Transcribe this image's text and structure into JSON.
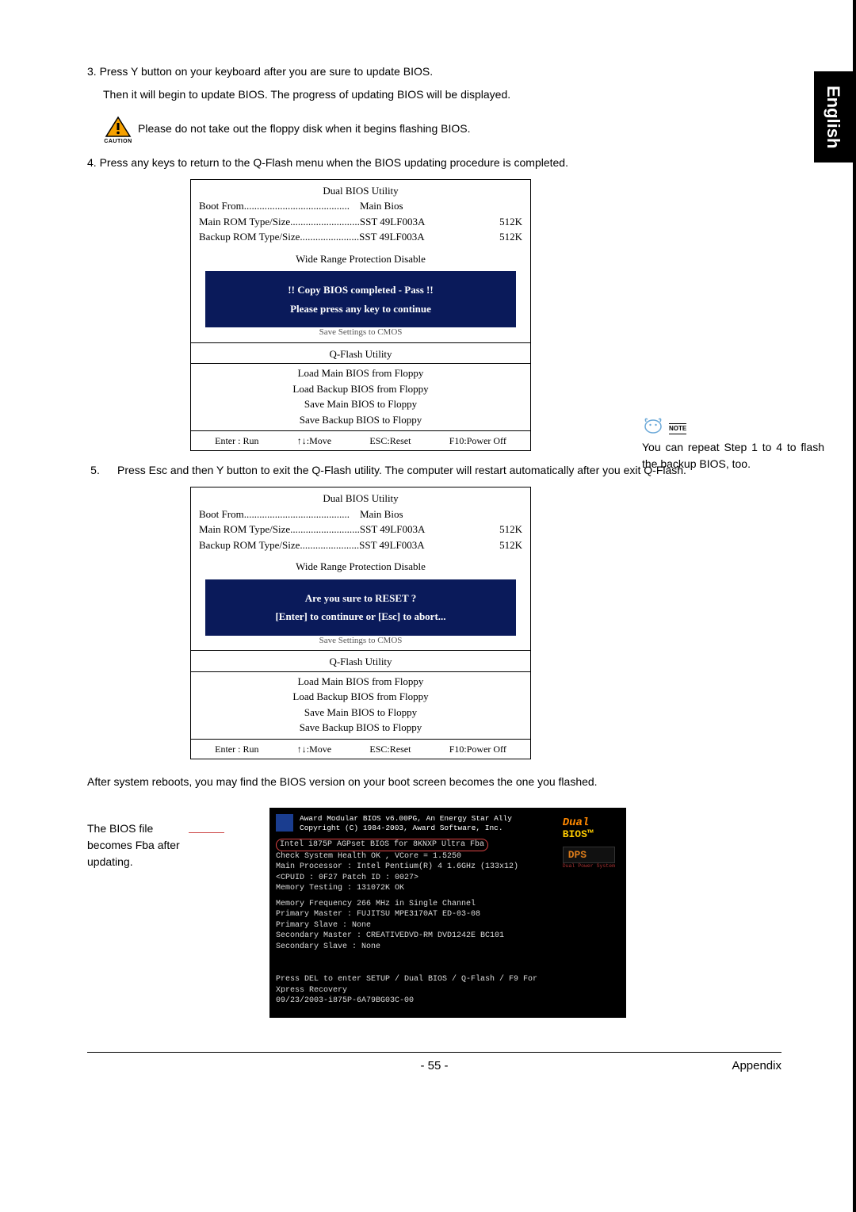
{
  "tab": "English",
  "step3": {
    "text": "3. Press Y button on your keyboard after you are sure to update BIOS.",
    "sub": "Then it will begin to update BIOS. The progress of updating BIOS will be displayed."
  },
  "caution": {
    "label": "CAUTION",
    "text": "Please do not take out the floppy disk when it begins flashing BIOS."
  },
  "step4": "4. Press any keys to return to the Q-Flash menu when the BIOS updating procedure is completed.",
  "bios1": {
    "title": "Dual BIOS Utility",
    "boot_from_lbl": "Boot From.........................................",
    "boot_from_val": "Main Bios",
    "main_rom_lbl": "Main ROM Type/Size...........................SST 49LF003A",
    "main_rom_val": "512K",
    "backup_rom_lbl": "Backup ROM Type/Size.......................SST 49LF003A",
    "backup_rom_val": "512K",
    "wrp": "Wide Range Protection     Disable",
    "banner1": "!! Copy BIOS completed - Pass !!",
    "banner2": "Please press any key to continue",
    "under": "Save Settings to CMOS",
    "qflash": "Q-Flash Utility",
    "m1": "Load Main BIOS from Floppy",
    "m2": "Load Backup BIOS from Floppy",
    "m3": "Save Main BIOS to Floppy",
    "m4": "Save Backup BIOS to Floppy",
    "f1": "Enter : Run",
    "f2": "↑↓:Move",
    "f3": "ESC:Reset",
    "f4": "F10:Power Off"
  },
  "note": {
    "label": "NOTE",
    "text": "You can repeat Step 1 to 4 to flash the backup BIOS, too."
  },
  "step5": {
    "num": "5.",
    "text": "Press Esc and then Y button to exit the Q-Flash utility. The computer will restart automatically after you exit Q-Flash."
  },
  "bios2": {
    "title": "Dual BIOS Utility",
    "boot_from_lbl": "Boot From.........................................",
    "boot_from_val": "Main Bios",
    "main_rom_lbl": "Main ROM Type/Size...........................SST 49LF003A",
    "main_rom_val": "512K",
    "backup_rom_lbl": "Backup ROM Type/Size.......................SST 49LF003A",
    "backup_rom_val": "512K",
    "wrp": "Wide Range Protection     Disable",
    "banner1": "Are you sure to RESET ?",
    "banner2": "[Enter] to continure or [Esc] to abort...",
    "under": "Save Settings to CMOS",
    "qflash": "Q-Flash Utility",
    "m1": "Load Main BIOS from Floppy",
    "m2": "Load Backup BIOS from Floppy",
    "m3": "Save Main BIOS to Floppy",
    "m4": "Save Backup BIOS to Floppy",
    "f1": "Enter : Run",
    "f2": "↑↓:Move",
    "f3": "ESC:Reset",
    "f4": "F10:Power Off"
  },
  "after_reboot": "After system reboots, you may find the BIOS version on your boot screen becomes the one you flashed.",
  "callout": "The BIOS file becomes Fba after updating.",
  "boot": {
    "l1": "Award Modular BIOS v6.00PG, An Energy Star Ally",
    "l2": "Copyright (C) 1984-2003, Award Software, Inc.",
    "l3": "Intel i875P AGPset BIOS for 8KNXP Ultra Fba",
    "l4": "Check System Health OK , VCore = 1.5250",
    "l5": "Main Processor : Intel Pentium(R) 4  1.6GHz (133x12)",
    "l6": "<CPUID : 0F27 Patch ID : 0027>",
    "l7": "Memory Testing  : 131072K OK",
    "l8": "Memory Frequency 266 MHz in Single Channel",
    "l9": "Primary Master : FUJITSU MPE3170AT ED-03-08",
    "l10": "Primary Slave : None",
    "l11": "Secondary Master : CREATIVEDVD-RM DVD1242E BC101",
    "l12": "Secondary Slave : None",
    "l13": "Press DEL to enter SETUP / Dual BIOS / Q-Flash / F9 For",
    "l14": "Xpress Recovery",
    "l15": "09/23/2003-i875P-6A79BG03C-00",
    "logo_dual": "Dual",
    "logo_bios": "BIOS™",
    "logo_dps": "DPS",
    "logo_dps_sub": "Dual Power System"
  },
  "footer": {
    "page": "- 55 -",
    "section": "Appendix"
  }
}
